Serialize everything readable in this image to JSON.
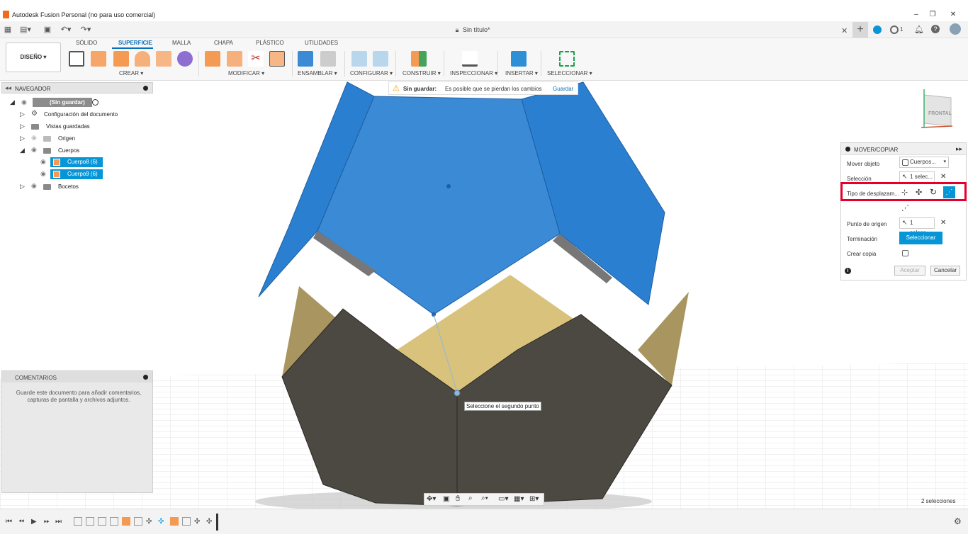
{
  "window": {
    "title": "Autodesk Fusion Personal (no para uso comercial)",
    "minimize": "–",
    "maximize": "❐",
    "close": "✕"
  },
  "appbar": {
    "doc_title": "Sin título*",
    "close": "✕",
    "plus": "+",
    "notif_count": "1"
  },
  "ribbon": {
    "design_button": "DISEÑO ▾",
    "tabs": [
      "SÓLIDO",
      "SUPERFICIE",
      "MALLA",
      "CHAPA",
      "PLÁSTICO",
      "UTILIDADES"
    ],
    "groups": [
      "CREAR ▾",
      "MODIFICAR ▾",
      "ENSAMBLAR ▾",
      "CONFIGURAR ▾",
      "CONSTRUIR ▾",
      "INSPECCIONAR ▾",
      "INSERTAR ▾",
      "SELECCIONAR ▾"
    ]
  },
  "navigator": {
    "title": "NAVEGADOR",
    "root": "(Sin guardar)",
    "items": [
      {
        "label": "Configuración del documento"
      },
      {
        "label": "Vistas guardadas"
      },
      {
        "label": "Origen"
      },
      {
        "label": "Cuerpos"
      },
      {
        "label": "Cuerpo8 (6)"
      },
      {
        "label": "Cuerpo9 (6)"
      },
      {
        "label": "Bocetos"
      }
    ]
  },
  "unsaved": {
    "label": "Sin guardar:",
    "message": "Es posible que se pierdan los cambios",
    "save": "Guardar"
  },
  "comments": {
    "title": "COMENTARIOS",
    "text": "Guarde este documento para añadir comentarios, capturas de pantalla y archivos adjuntos."
  },
  "viewcube": {
    "label": "FRONTAL"
  },
  "panel": {
    "title": "MOVER/COPIAR",
    "move_object_label": "Mover objeto",
    "move_object_value": "Cuerpos...",
    "selection_label": "Selección",
    "selection_value": "1 selec...",
    "move_type_label": "Tipo de desplazam...",
    "origin_label": "Punto de origen",
    "origin_value": "1 selecc...",
    "termination_label": "Terminación",
    "termination_button": "Seleccionar",
    "copy_label": "Crear copia",
    "accept": "Aceptar",
    "cancel": "Cancelar"
  },
  "tooltip": "Seleccione el segundo punto",
  "status": {
    "selections": "2 selecciones"
  },
  "colors": {
    "accent": "#0696d7",
    "highlight": "#e4002b",
    "blue_body": "#3a8ad6",
    "dark_body": "#4c4842",
    "tan_body": "#d9c27c"
  }
}
